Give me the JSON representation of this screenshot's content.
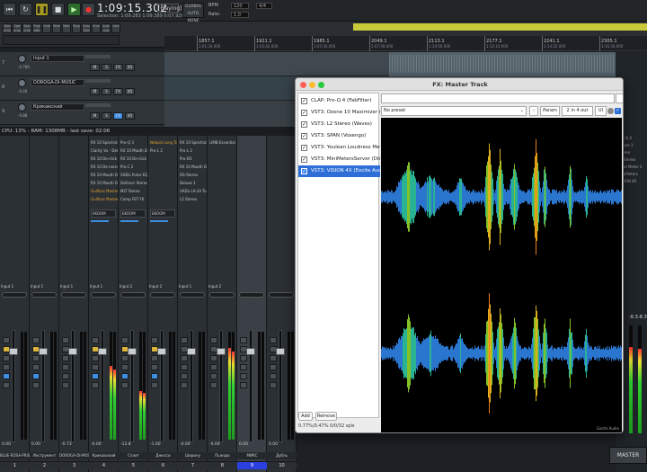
{
  "transport": {
    "time": "1:09:15.302",
    "status": "[Playing]",
    "global_auto": "GLOBAL AUTO",
    "none": "NONE",
    "rate_label": "Rate:",
    "rate_val": "1.0",
    "bpm": "120",
    "bpm_label": "BPM",
    "sig": "4/4",
    "selection": "Selection:  1:09:283     1:09:389     0:07.926"
  },
  "toolbar": {
    "items": [
      "New\nproject",
      "Open\nproject",
      "Save\nproject",
      "Project\nsettings",
      "Undo",
      "Redo",
      "Metronome",
      "Ripple",
      "Snap\nGrid",
      "Envelope",
      "Auto\ncrossfade",
      "Locking"
    ]
  },
  "ruler": {
    "marks": [
      {
        "bar": "1857.1",
        "time": "1:01:34.000"
      },
      {
        "bar": "1921.1",
        "time": "1:03:42.000"
      },
      {
        "bar": "1985.1",
        "time": "1:05:50.000"
      },
      {
        "bar": "2049.1",
        "time": "1:07:58.000"
      },
      {
        "bar": "2113.1",
        "time": "1:10:06.000"
      },
      {
        "bar": "2177.1",
        "time": "1:12:14.000"
      },
      {
        "bar": "2241.1",
        "time": "1:14:22.000"
      },
      {
        "bar": "2305.1",
        "time": "1:16:30.000"
      },
      {
        "bar": "2369.1",
        "time": "1:18:38.000"
      }
    ]
  },
  "tracks": [
    {
      "num": "7",
      "name": "Input 1",
      "db": "-0.786"
    },
    {
      "num": "8",
      "name": "DOROGA-DI-MUSIC",
      "db": "-0.40"
    },
    {
      "num": "9",
      "name": "Крикаюский",
      "db": "-0.88"
    }
  ],
  "cpu": "CPU: 13% - RAM: 1308MB - last save: 02:06",
  "mixer": {
    "strips": [
      {
        "input": "Input 1",
        "vol": "0.00",
        "name": "BLUE-ROSA-PRISTROKA",
        "num": "1",
        "fx": [],
        "route": "",
        "level": 0
      },
      {
        "input": "Input 1",
        "vol": "0.00",
        "name": "Инструмент",
        "num": "2",
        "fx": [],
        "route": "",
        "level": 0
      },
      {
        "input": "Input 1",
        "vol": "-0.73",
        "name": "DOROGA-DI-MUSIC",
        "num": "3",
        "fx": [],
        "route": "",
        "level": 0
      },
      {
        "input": "Input 1",
        "vol": "-0.00",
        "name": "Крикаюский",
        "num": "4",
        "fx": [
          "RX 10 Spectral De",
          "Clarity Vx - DeRev",
          "RX 10 De-click",
          "RX 10 De-noise",
          "RX 10 Mouth Deci",
          "RX 10 Mouth Deci",
          "Gullfoss Master",
          "Gullfoss Master"
        ],
        "route": "EKOOM",
        "level": 0.68
      },
      {
        "input": "Input 2",
        "vol": "-12.8",
        "name": "Сплит",
        "num": "5",
        "fx": [
          "Pro-Q 3",
          "RX 10 Mouth Deci",
          "RX 10 De-click",
          "Pro-C 2",
          "SADiL Pulse EQP",
          "DeEsser Stereo",
          "MLT Stereo",
          "Comp FET-76"
        ],
        "route": "EKOOM",
        "level": 0.45
      },
      {
        "input": "Input 2",
        "vol": "-1.00",
        "name": "Джесси",
        "num": "6",
        "fx": [
          "Nebula Long Tone",
          "Pro-L 2"
        ],
        "route": "EKOOM",
        "level": 0
      },
      {
        "input": "Input 1",
        "vol": "-0.00",
        "name": "Ширину",
        "num": "7",
        "fx": [
          "RX 10 Spectral De",
          "Pro-L 2",
          "Pro-DS",
          "RX 10 Mouth Deci",
          "DS-Stereo",
          "Deluxe 1",
          "UADx LA-2A Tube",
          "L2 Stereo"
        ],
        "route": "",
        "level": 0
      },
      {
        "input": "Input 2",
        "vol": "-0.00",
        "name": "Пьяндю",
        "num": "8",
        "fx": [
          "LIMB Essential"
        ],
        "route": "",
        "level": 0.85
      },
      {
        "input": "",
        "vol": "0.00",
        "name": "МИКС",
        "num": "9",
        "fx": [],
        "route": "",
        "level": 0
      },
      {
        "input": "",
        "vol": "0.00",
        "name": "Дубль",
        "num": "10",
        "fx": [],
        "route": "",
        "level": 0
      }
    ]
  },
  "right": {
    "fx": [
      "Pro-Q 4",
      "Ozone 1",
      "Stereo",
      "L2 Stereo",
      "Loud Meter 2",
      "MiniMeters",
      "VISION 4X"
    ],
    "master": "MASTER",
    "meters": [
      "-8.3",
      "-8.3"
    ]
  },
  "fxwin": {
    "title": "FX: Master Track",
    "preset": "No preset",
    "param": "Param",
    "io": "2 in 4 out",
    "ui": "UI",
    "items": [
      "CLAP: Pro-Q 4 (FabFilter)",
      "VST3: Ozone 10 Maximizer (iZoto",
      "VST3: L2 Stereo (Waves)",
      "VST3: SPAN (Voxengo)",
      "VST3: Youlean Loudness Meter 2",
      "VST3: MiniMetersServer (Direct)",
      "VST3: VISION 4X (Excite Audio)"
    ],
    "add": "Add",
    "remove": "Remove",
    "stat": "0.77%/0.47% 0/0/32 spls",
    "viz_label": "Excite Audio"
  }
}
